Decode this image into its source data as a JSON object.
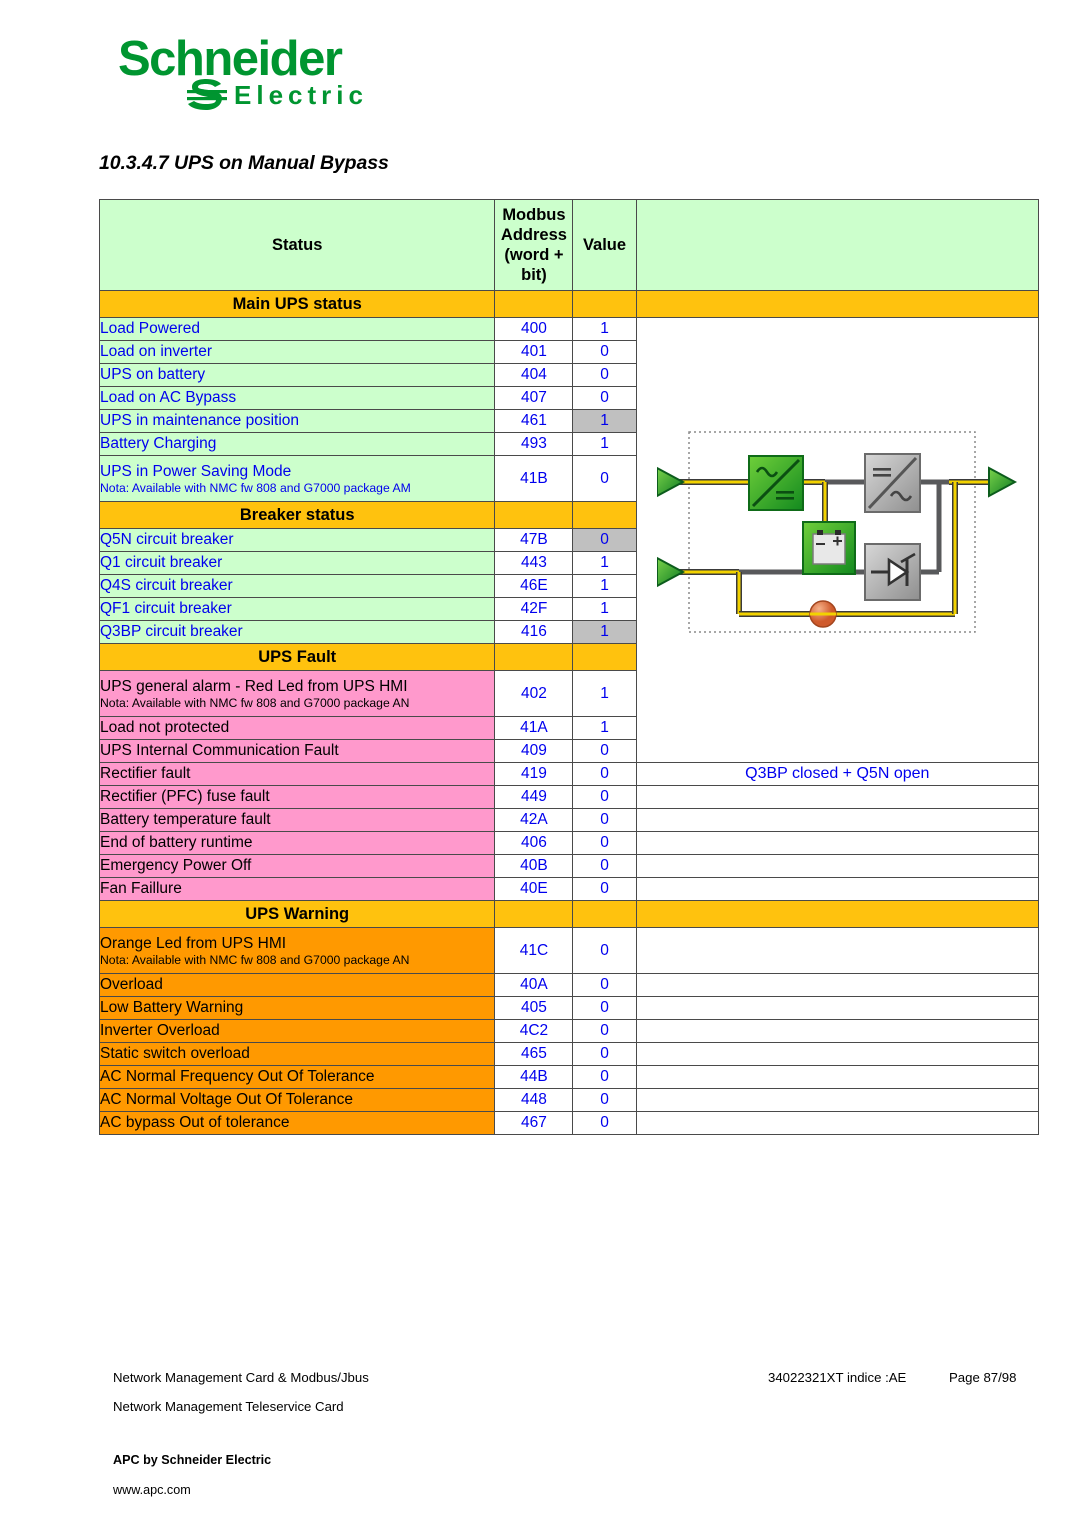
{
  "brand": {
    "name": "Schneider",
    "subname": "Electric",
    "logo_green": "#009530"
  },
  "heading": "10.3.4.7 UPS on Manual Bypass",
  "table": {
    "headers": {
      "status": "Status",
      "address": "Modbus Address (word + bit)",
      "address_line1": "Modbus",
      "address_line2": "Address",
      "address_line3": "(word +",
      "address_line4": "bit)",
      "value": "Value",
      "diagram": ""
    },
    "colors": {
      "section_header": "#FFC20E",
      "status_rows": "#CCFFCC",
      "fault_rows": "#FF99CC",
      "warning_rows": "#FF9900",
      "highlight_cell": "#C0C0C0",
      "text_blue": "#0000EE"
    },
    "sections": [
      {
        "title": "Main UPS status",
        "row_style": "green",
        "rows": [
          {
            "label": "Load Powered",
            "nota": "",
            "address": "400",
            "value": "1",
            "highlight": false
          },
          {
            "label": "Load on inverter",
            "nota": "",
            "address": "401",
            "value": "0",
            "highlight": false
          },
          {
            "label": "UPS on battery",
            "nota": "",
            "address": "404",
            "value": "0",
            "highlight": false
          },
          {
            "label": "Load on AC Bypass",
            "nota": "",
            "address": "407",
            "value": "0",
            "highlight": false
          },
          {
            "label": "UPS in maintenance position",
            "nota": "",
            "address": "461",
            "value": "1",
            "highlight": true
          },
          {
            "label": "Battery Charging",
            "nota": "",
            "address": "493",
            "value": "1",
            "highlight": false
          },
          {
            "label": "UPS in Power Saving Mode",
            "nota": "Nota: Available with NMC fw 808 and G7000 package AM",
            "address": "41B",
            "value": "0",
            "highlight": false
          }
        ]
      },
      {
        "title": "Breaker status",
        "row_style": "green",
        "rows": [
          {
            "label": "Q5N circuit breaker",
            "nota": "",
            "address": "47B",
            "value": "0",
            "highlight": true
          },
          {
            "label": "Q1 circuit breaker",
            "nota": "",
            "address": "443",
            "value": "1",
            "highlight": false
          },
          {
            "label": "Q4S circuit breaker",
            "nota": "",
            "address": "46E",
            "value": "1",
            "highlight": false
          },
          {
            "label": "QF1 circuit breaker",
            "nota": "",
            "address": "42F",
            "value": "1",
            "highlight": false
          },
          {
            "label": "Q3BP circuit breaker",
            "nota": "",
            "address": "416",
            "value": "1",
            "highlight": true
          }
        ]
      },
      {
        "title": "UPS Fault",
        "row_style": "pink",
        "rows": [
          {
            "label": "UPS general alarm - Red Led from UPS HMI",
            "nota": "Nota: Available with NMC fw 808 and G7000 package AN",
            "address": "402",
            "value": "1",
            "highlight": false
          },
          {
            "label": "Load not protected",
            "nota": "",
            "address": "41A",
            "value": "1",
            "highlight": false
          },
          {
            "label": "UPS Internal Communication Fault",
            "nota": "",
            "address": "409",
            "value": "0",
            "highlight": false
          },
          {
            "label": "Rectifier fault",
            "nota": "",
            "address": "419",
            "value": "0",
            "highlight": false
          },
          {
            "label": "Rectifier (PFC) fuse fault",
            "nota": "",
            "address": "449",
            "value": "0",
            "highlight": false
          },
          {
            "label": "Battery temperature fault",
            "nota": "",
            "address": "42A",
            "value": "0",
            "highlight": false
          },
          {
            "label": "End of battery runtime",
            "nota": "",
            "address": "406",
            "value": "0",
            "highlight": false
          },
          {
            "label": "Emergency Power Off",
            "nota": "",
            "address": "40B",
            "value": "0",
            "highlight": false
          },
          {
            "label": "Fan Faillure",
            "nota": "",
            "address": "40E",
            "value": "0",
            "highlight": false
          }
        ]
      },
      {
        "title": "UPS Warning",
        "row_style": "orange",
        "rows": [
          {
            "label": "Orange Led from UPS HMI",
            "nota": "Nota: Available with NMC fw 808 and G7000 package AN",
            "address": "41C",
            "value": "0",
            "highlight": false
          },
          {
            "label": "Overload",
            "nota": "",
            "address": "40A",
            "value": "0",
            "highlight": false
          },
          {
            "label": "Low Battery Warning",
            "nota": "",
            "address": "405",
            "value": "0",
            "highlight": false
          },
          {
            "label": "Inverter Overload",
            "nota": "",
            "address": "4C2",
            "value": "0",
            "highlight": false
          },
          {
            "label": "Static switch overload",
            "nota": "",
            "address": "465",
            "value": "0",
            "highlight": false
          },
          {
            "label": "AC Normal Frequency Out Of Tolerance",
            "nota": "",
            "address": "44B",
            "value": "0",
            "highlight": false
          },
          {
            "label": "AC Normal Voltage Out Of Tolerance",
            "nota": "",
            "address": "448",
            "value": "0",
            "highlight": false
          },
          {
            "label": "AC bypass Out of tolerance",
            "nota": "",
            "address": "467",
            "value": "0",
            "highlight": false
          }
        ]
      }
    ],
    "diagram_caption": "Q3BP closed + Q5N open"
  },
  "diagram": {
    "blocks": [
      {
        "name": "rectifier",
        "symbol": "AC/DC",
        "color": "#2FA82F"
      },
      {
        "name": "inverter",
        "symbol": "DC/AC",
        "color": "#9A9A9A"
      },
      {
        "name": "battery",
        "symbol": "battery",
        "color": "#2FA82F"
      },
      {
        "name": "static-switch",
        "symbol": "thyristor",
        "color": "#9A9A9A"
      },
      {
        "name": "manual-bypass-breaker",
        "symbol": "breaker",
        "color": "#E07A4A"
      }
    ],
    "inputs": [
      "AC Normal input",
      "AC Bypass input"
    ],
    "outputs": [
      "Load output"
    ]
  },
  "footer": {
    "line1": "Network Management Card & Modbus/Jbus",
    "line2": "Network Management Teleservice Card",
    "doc_ref": "34022321XT indice :AE",
    "page": "Page 87/98",
    "company": "APC by Schneider Electric",
    "url": "www.apc.com"
  }
}
